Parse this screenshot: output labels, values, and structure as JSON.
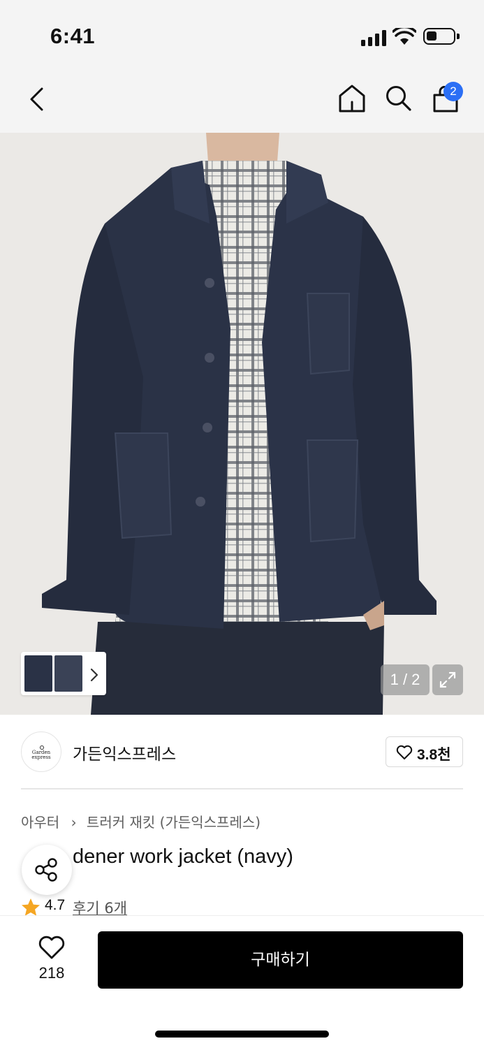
{
  "status_bar": {
    "time": "6:41"
  },
  "nav": {
    "icons": [
      "back-icon",
      "home-icon",
      "search-icon",
      "cart-icon"
    ],
    "cart_badge": "2"
  },
  "gallery": {
    "page_indicator": "1 / 2",
    "current_page": 1,
    "total_pages": 2
  },
  "brand": {
    "logo_line1": "Garden",
    "logo_line2": "express",
    "name": "가든익스프레스",
    "followers": "3.8천"
  },
  "product": {
    "breadcrumb": [
      "아우터",
      "트러커 재킷 (가든익스프레스)"
    ],
    "title_visible": "dener work jacket (navy)",
    "rating": "4.7",
    "review_link": "후기 6개"
  },
  "bottom": {
    "wish_count": "218",
    "buy_label": "구매하기"
  },
  "colors": {
    "accent_badge": "#2b6ff5",
    "star": "#f5a623",
    "buy_button": "#000000",
    "jacket": "#2a3246"
  }
}
